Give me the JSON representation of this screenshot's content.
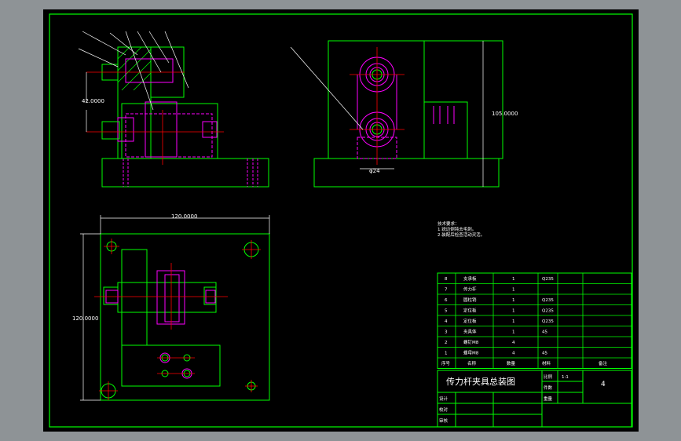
{
  "colors": {
    "background": "#000000",
    "frame": "#00ff00",
    "part": "#00ff00",
    "hidden": "#ff00ff",
    "center": "#ff0000",
    "dimension": "#ffffff"
  },
  "dimensions": {
    "d1": "42.0000",
    "d2": "105.0000",
    "d3": "120.0000",
    "d4": "120.0000",
    "d5": "φ24"
  },
  "notes": {
    "title": "技术要求：",
    "line1": "1.锐边倒钝去毛刺。",
    "line2": "2.装配后检查活动灵活。"
  },
  "bom_rows": [
    {
      "no": "8",
      "name": "支承板",
      "qty": "1",
      "mat": "Q235"
    },
    {
      "no": "7",
      "name": "传力杆",
      "qty": "1",
      "mat": ""
    },
    {
      "no": "6",
      "name": "圆柱销",
      "qty": "1",
      "mat": "Q235"
    },
    {
      "no": "5",
      "name": "定位板",
      "qty": "1",
      "mat": "Q235"
    },
    {
      "no": "4",
      "name": "定位板",
      "qty": "1",
      "mat": "Q235"
    },
    {
      "no": "3",
      "name": "夹具体",
      "qty": "1",
      "mat": "45"
    },
    {
      "no": "2",
      "name": "螺钉M8",
      "qty": "4",
      "mat": ""
    },
    {
      "no": "1",
      "name": "螺母M8",
      "qty": "4",
      "mat": "45"
    }
  ],
  "bom_header": {
    "no": "序号",
    "name": "名称",
    "qty": "数量",
    "mat": "材料",
    "remark": "备注"
  },
  "title_block": {
    "title": "传力杆夹具总装图",
    "sheet_no": "4",
    "ratio_label": "比例",
    "weight_label": "件数",
    "ratio_value": "1:1",
    "weight_value": "",
    "material_label": "重量",
    "design_label": "设计",
    "check_label": "校对",
    "approve_label": "审核"
  }
}
